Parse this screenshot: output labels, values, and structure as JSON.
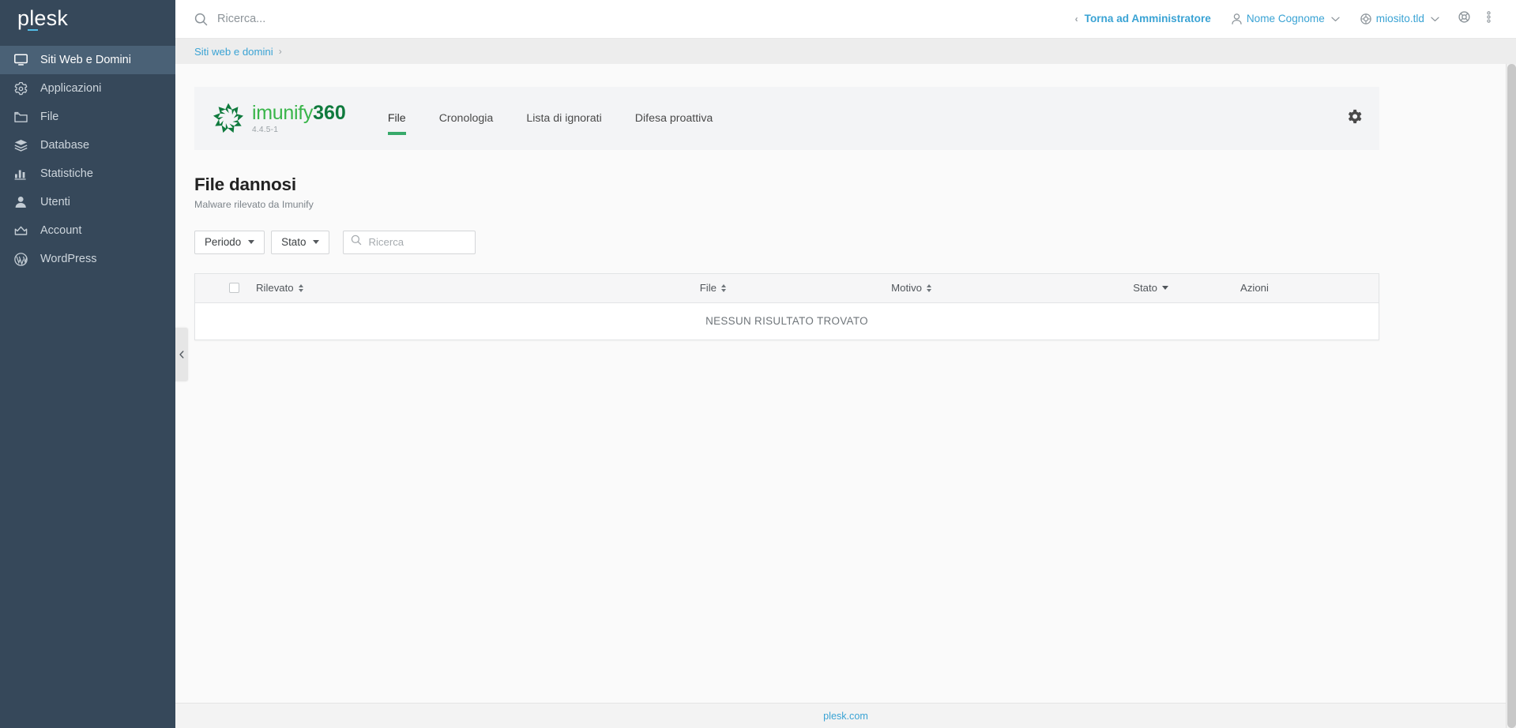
{
  "brand": {
    "name": "plesk"
  },
  "sidebar": {
    "items": [
      {
        "label": "Siti Web e Domini",
        "icon": "monitor-icon",
        "active": true
      },
      {
        "label": "Applicazioni",
        "icon": "gear-icon",
        "active": false
      },
      {
        "label": "File",
        "icon": "folder-icon",
        "active": false
      },
      {
        "label": "Database",
        "icon": "layers-icon",
        "active": false
      },
      {
        "label": "Statistiche",
        "icon": "bar-chart-icon",
        "active": false
      },
      {
        "label": "Utenti",
        "icon": "user-icon",
        "active": false
      },
      {
        "label": "Account",
        "icon": "crown-icon",
        "active": false
      },
      {
        "label": "WordPress",
        "icon": "wordpress-icon",
        "active": false
      }
    ],
    "collapse_handle_icon": "chevron-left-icon"
  },
  "topbar": {
    "search": {
      "placeholder": "Ricerca...",
      "value": "",
      "icon": "search-icon"
    },
    "back_to_admin": {
      "label": "Torna ad Amministratore",
      "icon": "chevron-left-icon"
    },
    "user": {
      "label": "Nome Cognome",
      "icon": "user-icon",
      "caret": "chevron-down-icon"
    },
    "domain": {
      "label": "miosito.tld",
      "icon": "globe-icon",
      "caret": "chevron-down-icon"
    },
    "help_icon": "lifebuoy-icon",
    "more_icon": "kebab-menu-icon"
  },
  "breadcrumb": {
    "items": [
      {
        "label": "Siti web e domini",
        "link": true
      }
    ],
    "separator": "›"
  },
  "imunify": {
    "logo": {
      "name_light": "imunify",
      "name_bold": "360",
      "version": "4.4.5-1"
    },
    "tabs": [
      {
        "label": "File",
        "active": true
      },
      {
        "label": "Cronologia",
        "active": false
      },
      {
        "label": "Lista di ignorati",
        "active": false
      },
      {
        "label": "Difesa proattiva",
        "active": false
      }
    ],
    "settings_icon": "gear-icon",
    "active_tab_color": "#37a96a"
  },
  "page": {
    "title": "File dannosi",
    "subtitle": "Malware rilevato da Imunify"
  },
  "filters": {
    "period": {
      "label": "Periodo",
      "caret": "chevron-down-icon"
    },
    "status": {
      "label": "Stato",
      "caret": "chevron-down-icon"
    },
    "search": {
      "placeholder": "Ricerca",
      "value": "",
      "icon": "search-icon"
    }
  },
  "table": {
    "select_all_checked": false,
    "columns": [
      {
        "key": "rilevato",
        "label": "Rilevato",
        "sortable": true,
        "sort": "none"
      },
      {
        "key": "file",
        "label": "File",
        "sortable": true,
        "sort": "none"
      },
      {
        "key": "motivo",
        "label": "Motivo",
        "sortable": true,
        "sort": "none"
      },
      {
        "key": "stato",
        "label": "Stato",
        "sortable": true,
        "sort": "desc"
      },
      {
        "key": "azioni",
        "label": "Azioni",
        "sortable": false,
        "sort": "none"
      }
    ],
    "rows": [],
    "empty_message": "NESSUN RISULTATO TROVATO"
  },
  "footer": {
    "link_label": "plesk.com"
  },
  "colors": {
    "sidebar_bg": "#36485a",
    "sidebar_active": "#4a6176",
    "accent_link": "#3aa3d4",
    "imunify_green": "#39b54a",
    "imunify_green_dark": "#0f7a3d",
    "tab_underline": "#37a96a"
  }
}
